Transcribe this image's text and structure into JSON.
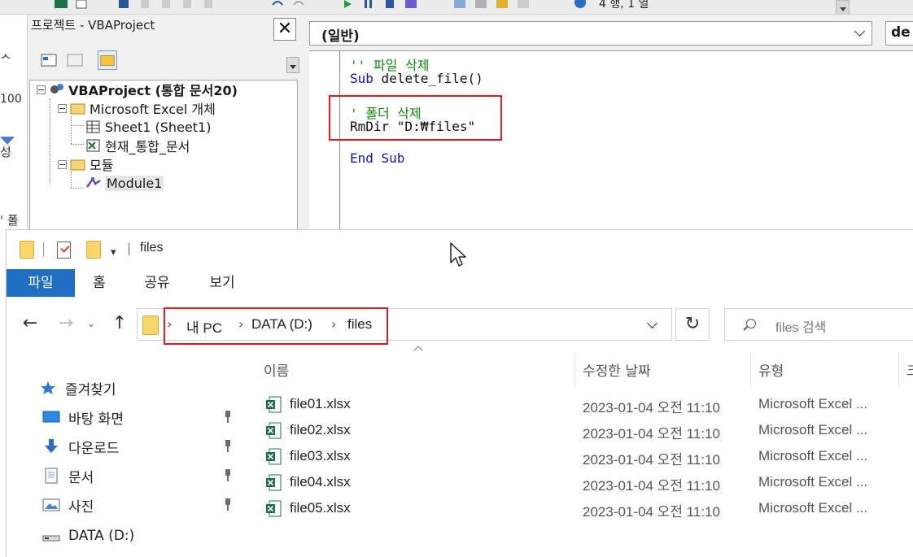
{
  "vbe": {
    "toolbar_status": "4 행, 1 열",
    "excel_strip": [
      "ᄉ",
      "100",
      "성",
      "' 폴"
    ],
    "project_pane": {
      "title": "프로젝트 - VBAProject",
      "close_label": "✕",
      "tree": [
        {
          "label": "VBAProject (통합 문서20)",
          "icon": "vba-project-icon"
        },
        {
          "label": "Microsoft Excel 개체",
          "icon": "folder-open-icon"
        },
        {
          "label": "Sheet1 (Sheet1)",
          "icon": "worksheet-icon"
        },
        {
          "label": "현재_통합_문서",
          "icon": "workbook-icon"
        },
        {
          "label": "모듈",
          "icon": "folder-open-icon"
        },
        {
          "label": "Module1",
          "icon": "module-icon"
        }
      ]
    },
    "code_pane": {
      "object_combo": "(일반)",
      "proc_combo": "de",
      "lines": [
        {
          "text": "'' 파일 삭제",
          "kind": "comment"
        },
        {
          "text": "Sub delete_file()",
          "kind": "sub"
        },
        {
          "text": "",
          "kind": "plain"
        },
        {
          "text": "' 폴더 삭제",
          "kind": "comment"
        },
        {
          "text": "RmDir \"D:₩files\"",
          "kind": "plain"
        },
        {
          "text": "",
          "kind": "plain"
        },
        {
          "text": "End Sub",
          "kind": "keyword"
        }
      ]
    }
  },
  "explorer": {
    "window_title": "files",
    "ribbon_tabs": [
      "파일",
      "홈",
      "공유",
      "보기"
    ],
    "active_tab": "파일",
    "breadcrumb": [
      "내 PC",
      "DATA (D:)",
      "files"
    ],
    "search_placeholder": "files 검색",
    "nav": {
      "favorites": "즐겨찾기",
      "items": [
        {
          "label": "바탕 화면",
          "icon": "desktop-icon",
          "pinned": true
        },
        {
          "label": "다운로드",
          "icon": "download-icon",
          "pinned": true
        },
        {
          "label": "문서",
          "icon": "documents-icon",
          "pinned": true
        },
        {
          "label": "사진",
          "icon": "pictures-icon",
          "pinned": true
        },
        {
          "label": "DATA (D:)",
          "icon": "drive-icon",
          "pinned": false
        }
      ]
    },
    "columns": [
      "이름",
      "수정한 날짜",
      "유형",
      "크"
    ],
    "files": [
      {
        "name": "file01.xlsx",
        "date": "2023-01-04 오전 11:10",
        "type": "Microsoft Excel ..."
      },
      {
        "name": "file02.xlsx",
        "date": "2023-01-04 오전 11:10",
        "type": "Microsoft Excel ..."
      },
      {
        "name": "file03.xlsx",
        "date": "2023-01-04 오전 11:10",
        "type": "Microsoft Excel ..."
      },
      {
        "name": "file04.xlsx",
        "date": "2023-01-04 오전 11:10",
        "type": "Microsoft Excel ..."
      },
      {
        "name": "file05.xlsx",
        "date": "2023-01-04 오전 11:10",
        "type": "Microsoft Excel ..."
      }
    ]
  },
  "colors": {
    "highlight_red": "#e01b24",
    "ribbon_active": "#1f6fc5",
    "code_comment": "#0a8a0a",
    "code_keyword": "#1410b4"
  }
}
